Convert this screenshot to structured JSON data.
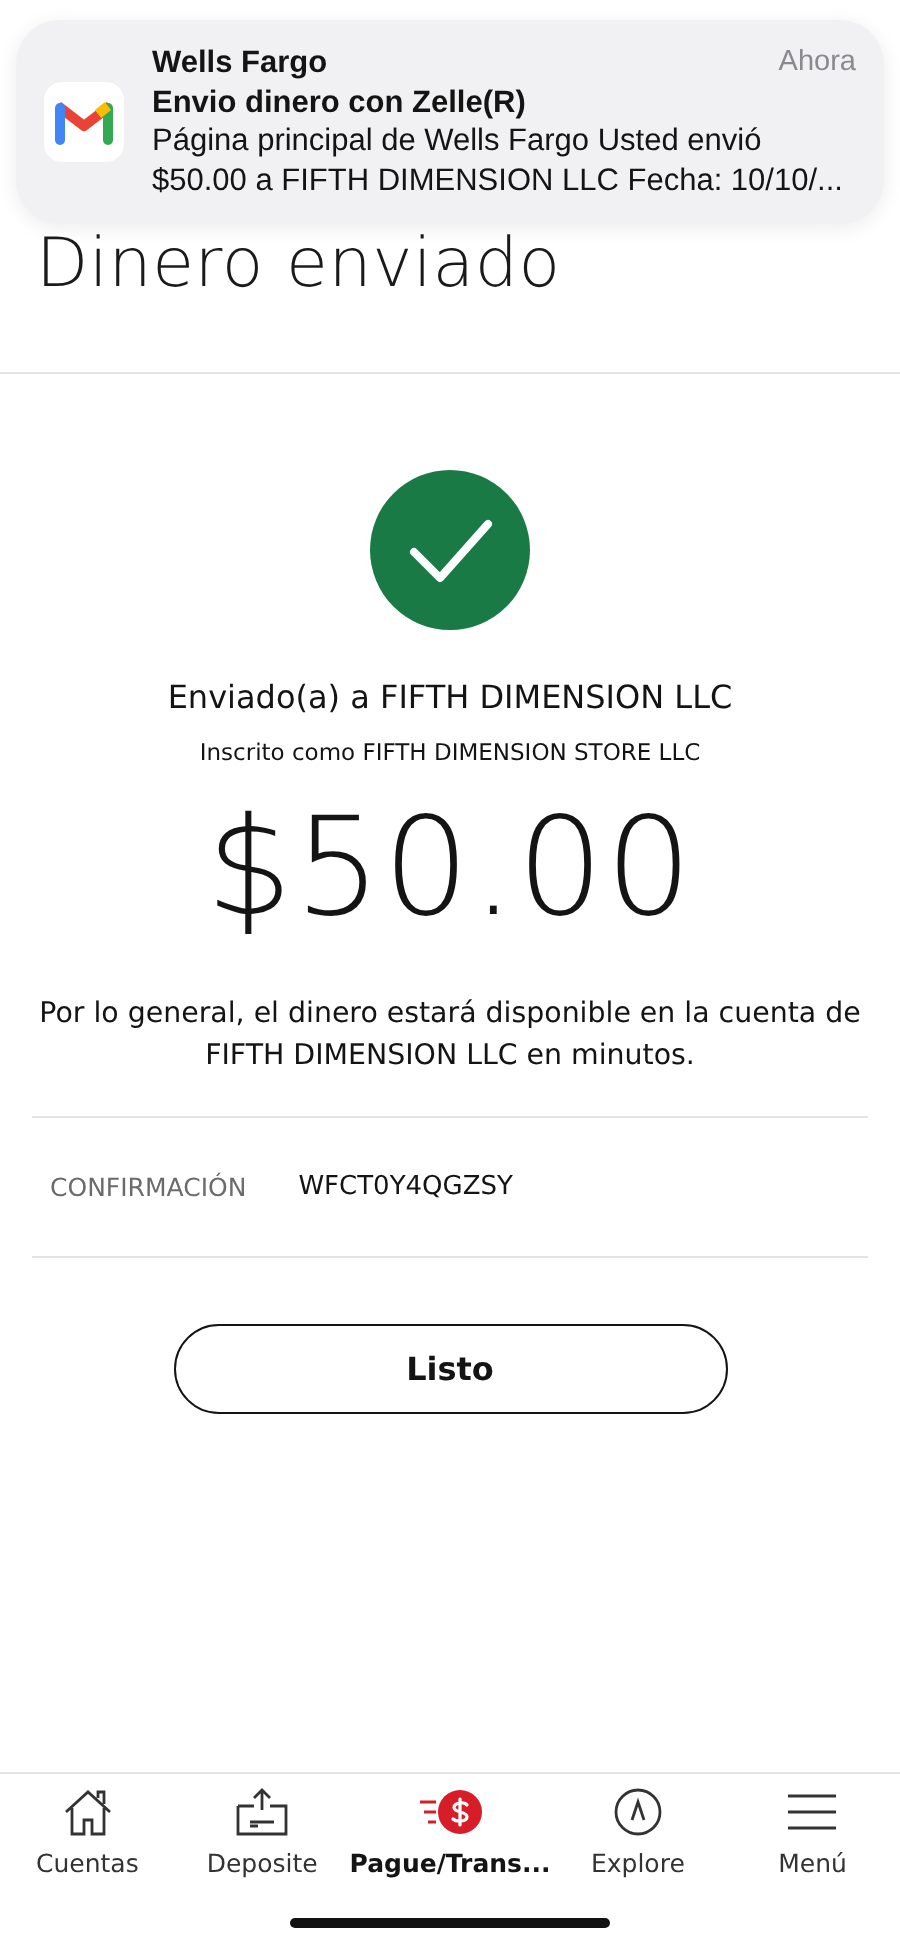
{
  "notification": {
    "app": "Wells Fargo",
    "time": "Ahora",
    "subject": "Envio dinero con Zelle(R)",
    "body": "Página principal de Wells Fargo Usted envió $50.00 a FIFTH DIMENSION LLC Fecha: 10/10/..."
  },
  "page": {
    "title": "Dinero enviado"
  },
  "confirmation": {
    "recipient": "Enviado(a) a FIFTH DIMENSION LLC",
    "enrolled_as": "Inscrito como FIFTH DIMENSION STORE LLC",
    "amount": "$50.00",
    "note": "Por lo general, el dinero estará disponible en la cuenta de FIFTH DIMENSION LLC en minutos.",
    "detail_label": "CONFIRMACIÓN",
    "detail_value": "WFCT0Y4QGZSY",
    "button": "Listo"
  },
  "tab_bar": [
    {
      "label": "Cuentas",
      "selected": false
    },
    {
      "label": "Deposite",
      "selected": false
    },
    {
      "label": "Pague/Trans...",
      "selected": true
    },
    {
      "label": "Explore",
      "selected": false
    },
    {
      "label": "Menú",
      "selected": false
    }
  ]
}
